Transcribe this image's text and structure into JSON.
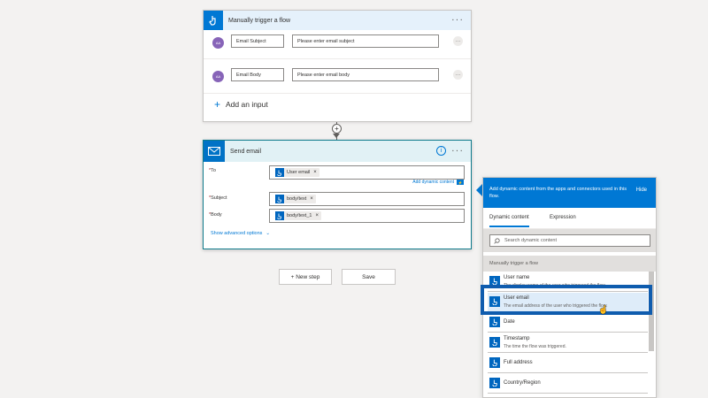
{
  "trigger": {
    "title": "Manually trigger a flow",
    "inputs": [
      {
        "avatar": "AA",
        "label": "Email Subject",
        "placeholder": "Please enter email subject"
      },
      {
        "avatar": "AA",
        "label": "Email Body",
        "placeholder": "Please enter email body"
      }
    ],
    "add_input": "Add an input"
  },
  "send_email": {
    "title": "Send email",
    "fields": [
      {
        "label": "To",
        "token": "User email"
      },
      {
        "label": "Subject",
        "token": "body/text"
      },
      {
        "label": "Body",
        "token": "body/text_1"
      }
    ],
    "add_dynamic": "Add dynamic content",
    "show_advanced": "Show advanced options"
  },
  "actions": {
    "new_step": "+ New step",
    "save": "Save"
  },
  "dynamic_panel": {
    "header_text": "Add dynamic content from the apps and connectors used in this flow.",
    "hide": "Hide",
    "tabs": [
      "Dynamic content",
      "Expression"
    ],
    "search_placeholder": "Search dynamic content",
    "section": "Manually trigger a flow",
    "items": [
      {
        "name": "User name",
        "desc": "The display name of the user who triggered the flow."
      },
      {
        "name": "User email",
        "desc": "The email address of the user who triggered the flow."
      },
      {
        "name": "Date",
        "desc": ""
      },
      {
        "name": "Timestamp",
        "desc": "The time the flow was triggered."
      },
      {
        "name": "Full address",
        "desc": ""
      },
      {
        "name": "Country/Region",
        "desc": ""
      }
    ]
  },
  "colors": {
    "accent": "#0078d4",
    "trigger_header": "#e5f1fb",
    "email_icon": "#0072c6"
  }
}
